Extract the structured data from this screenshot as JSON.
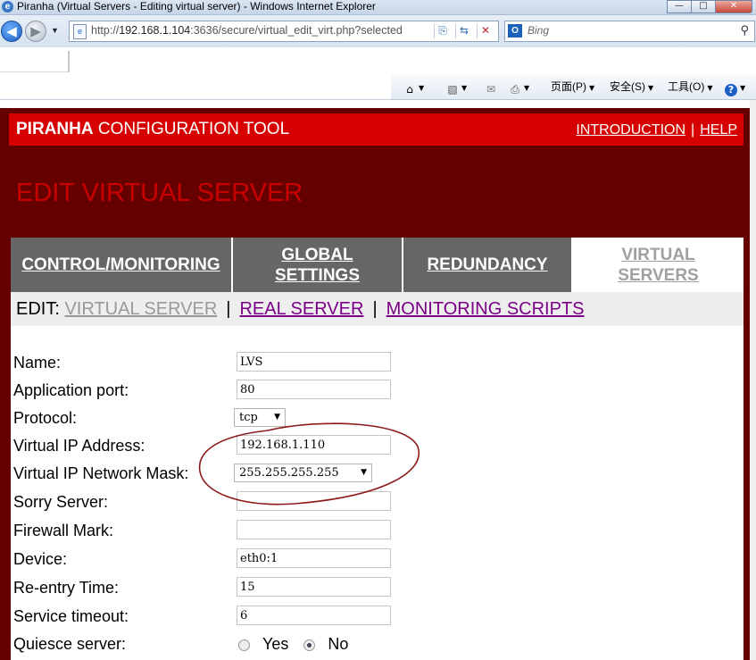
{
  "window": {
    "title": "Piranha (Virtual Servers - Editing virtual server) - Windows Internet Explorer",
    "min": "—",
    "max": "□",
    "close": "✕"
  },
  "addressbar": {
    "url_prefix": "http://",
    "url_host": "192.168.1.104",
    "url_rest": ":3636/secure/virtual_edit_virt.php?selected",
    "search_placeholder": "Bing"
  },
  "commandbar": {
    "page_menu": "页面(P)",
    "safety_menu": "安全(S)",
    "tools_menu": "工具(O)"
  },
  "header": {
    "brand_bold": "PIRANHA",
    "brand_rest": " CONFIGURATION TOOL",
    "link_intro": "INTRODUCTION",
    "link_help": "HELP"
  },
  "section_title": "EDIT VIRTUAL SERVER",
  "tabs": [
    {
      "line1": "CONTROL/MONITORING",
      "line2": ""
    },
    {
      "line1": "GLOBAL",
      "line2": "SETTINGS"
    },
    {
      "line1": "REDUNDANCY",
      "line2": ""
    },
    {
      "line1": "VIRTUAL",
      "line2": "SERVERS"
    }
  ],
  "subnav": {
    "label": "EDIT:",
    "virtual_server": "VIRTUAL SERVER",
    "real_server": "REAL SERVER",
    "monitoring_scripts": "MONITORING SCRIPTS",
    "pipe": "|"
  },
  "form": {
    "name": {
      "label": "Name:",
      "value": "LVS"
    },
    "app_port": {
      "label": "Application port:",
      "value": "80"
    },
    "protocol": {
      "label": "Protocol:",
      "value": "tcp"
    },
    "vip": {
      "label": "Virtual IP Address:",
      "value": "192.168.1.110"
    },
    "netmask": {
      "label": "Virtual IP Network Mask:",
      "value": "255.255.255.255"
    },
    "sorry": {
      "label": "Sorry Server:",
      "value": ""
    },
    "fwmark": {
      "label": "Firewall Mark:",
      "value": ""
    },
    "device": {
      "label": "Device:",
      "value": "eth0:1"
    },
    "reentry": {
      "label": "Re-entry Time:",
      "value": "15"
    },
    "timeout": {
      "label": "Service timeout:",
      "value": "6"
    },
    "quiesce": {
      "label": "Quiesce server:",
      "yes": "Yes",
      "no": "No",
      "selected": "No"
    }
  },
  "colors": {
    "frame": "#650000",
    "header": "#d60000",
    "tab_dark": "#666666",
    "link_visited": "#7a0087",
    "annotation": "#8b1a1a"
  }
}
